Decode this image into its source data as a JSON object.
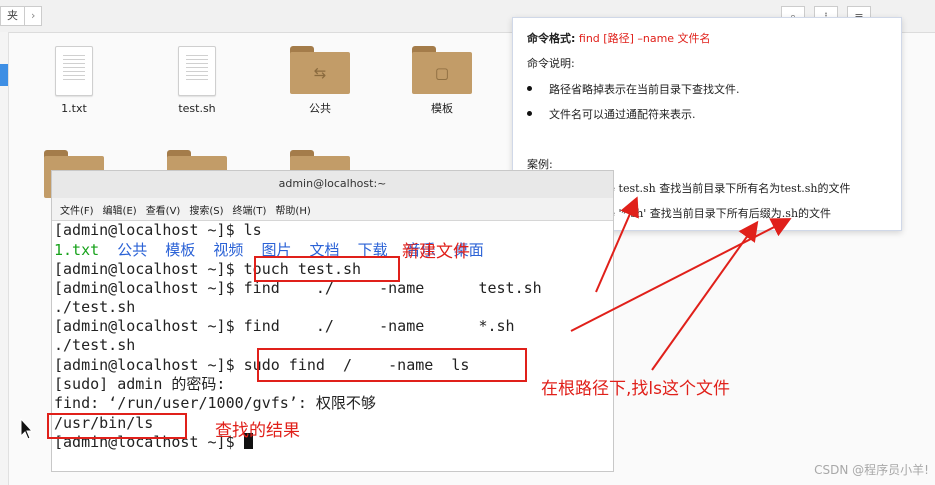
{
  "file_manager": {
    "breadcrumb": "夹",
    "files": [
      {
        "name": "1.txt",
        "kind": "doc"
      },
      {
        "name": "test.sh",
        "kind": "doc"
      },
      {
        "name": "公共",
        "kind": "folder-share"
      },
      {
        "name": "模板",
        "kind": "folder-template"
      }
    ]
  },
  "popup": {
    "format_label": "命令格式:",
    "format_value": "find [路径] –name 文件名",
    "desc_label": "命令说明:",
    "desc_items": [
      "路径省略掉表示在当前目录下查找文件.",
      "文件名可以通过通配符来表示."
    ],
    "cases_label": "案例:",
    "case_items": [
      "find . –name test.sh 查找当前目录下所有名为test.sh的文件",
      "find . –name '*.sh' 查找当前目录下所有后缀为.sh的文件"
    ]
  },
  "terminal": {
    "title": "admin@localhost:~",
    "menu": [
      "文件(F)",
      "编辑(E)",
      "查看(V)",
      "搜索(S)",
      "终端(T)",
      "帮助(H)"
    ],
    "lines": [
      {
        "prompt": "[admin@localhost ~]$ ",
        "cmd": "ls"
      },
      {
        "ls_out": [
          "1.txt",
          "公共",
          "模板",
          "视频",
          "图片",
          "文档",
          "下载",
          "音乐",
          "桌面"
        ]
      },
      {
        "prompt": "[admin@localhost ~]$ ",
        "cmd": "touch test.sh"
      },
      {
        "prompt": "[admin@localhost ~]$ ",
        "cmd": "find    ./     -name      test.sh"
      },
      {
        "out": "./test.sh"
      },
      {
        "prompt": "[admin@localhost ~]$ ",
        "cmd": "find    ./     -name      *.sh"
      },
      {
        "out": "./test.sh"
      },
      {
        "prompt": "[admin@localhost ~]$ ",
        "cmd": "sudo find  /    -name  ls"
      },
      {
        "out": "[sudo] admin 的密码:"
      },
      {
        "out": "find: ‘/run/user/1000/gvfs’: 权限不够"
      },
      {
        "out": "/usr/bin/ls"
      },
      {
        "prompt": "[admin@localhost ~]$ ",
        "cmd": ""
      }
    ]
  },
  "annotations": {
    "new_file": "新建文件",
    "root_search": "在根路径下,找ls这个文件",
    "result": "查找的结果"
  },
  "watermark": "CSDN @程序员小羊!",
  "colors": {
    "accent_red": "#e0201a",
    "ls_green": "#17a21b",
    "ls_blue": "#2b62d6"
  }
}
